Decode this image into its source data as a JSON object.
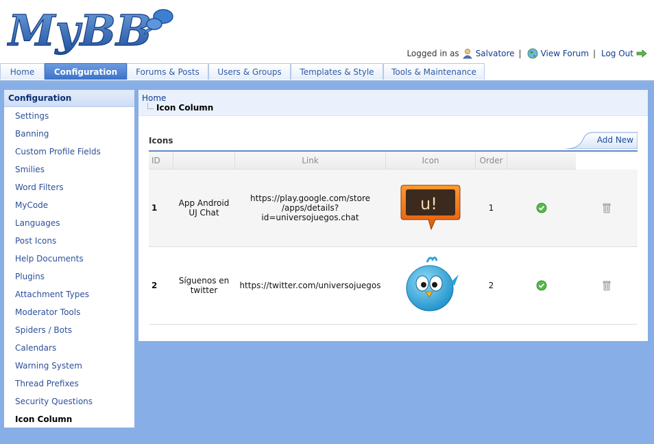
{
  "header": {
    "logo_text": "MyBB",
    "logged_in_as": "Logged in as",
    "username": "Salvatore",
    "view_forum": "View Forum",
    "logout": "Log Out",
    "separator": "|"
  },
  "tabs": [
    {
      "label": "Home"
    },
    {
      "label": "Configuration",
      "active": true
    },
    {
      "label": "Forums & Posts"
    },
    {
      "label": "Users & Groups"
    },
    {
      "label": "Templates & Style"
    },
    {
      "label": "Tools & Maintenance"
    }
  ],
  "sidebar": {
    "title": "Configuration",
    "items": [
      "Settings",
      "Banning",
      "Custom Profile Fields",
      "Smilies",
      "Word Filters",
      "MyCode",
      "Languages",
      "Post Icons",
      "Help Documents",
      "Plugins",
      "Attachment Types",
      "Moderator Tools",
      "Spiders / Bots",
      "Calendars",
      "Warning System",
      "Thread Prefixes",
      "Security Questions",
      "Icon Column"
    ],
    "active_item": "Icon Column"
  },
  "breadcrumb": {
    "home": "Home",
    "current": "Icon Column"
  },
  "table": {
    "title": "Icons",
    "add_new": "Add New",
    "columns": [
      "ID",
      "",
      "Link",
      "Icon",
      "Order",
      ""
    ],
    "rows": [
      {
        "id": "1",
        "name_line1": "App Android",
        "name_line2": "UJ Chat",
        "link_line1": "https://play.google.com/store",
        "link_line2": "/apps/details?id=universojuegos.chat",
        "icon": "uj-chat-icon",
        "order": "1",
        "status_icon": "check-icon",
        "delete_icon": "trash-icon"
      },
      {
        "id": "2",
        "name_line1": "Síguenos en",
        "name_line2": "twitter",
        "link_line1": "https://twitter.com/universojuegos",
        "link_line2": "",
        "icon": "twitter-bird-icon",
        "order": "2",
        "status_icon": "check-icon",
        "delete_icon": "trash-icon"
      }
    ]
  },
  "colors": {
    "background": "#87aee6",
    "tab_active": "#4a80d4",
    "link": "#0f3a8e",
    "header_rule": "#5e88cc",
    "check_green": "#3fa53b"
  }
}
